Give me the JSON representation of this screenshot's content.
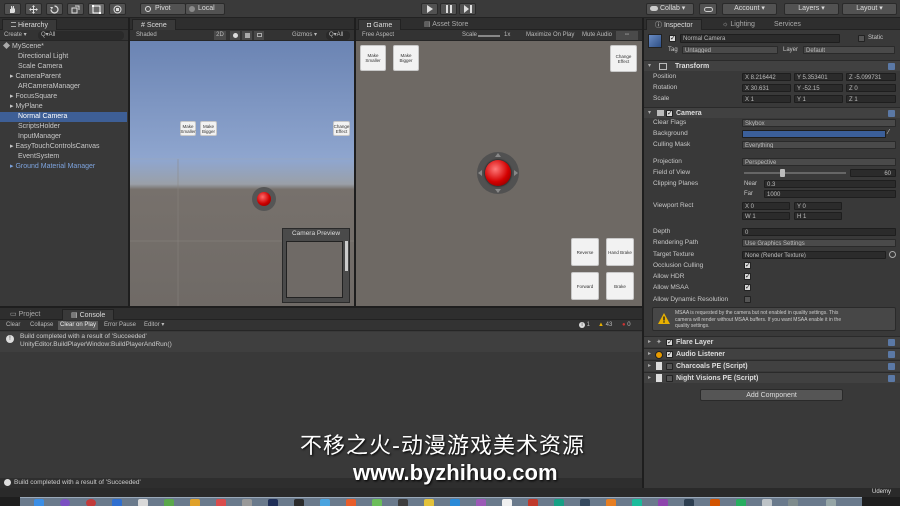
{
  "toolbar": {
    "pivot_label": "Pivot",
    "local_label": "Local",
    "collab_label": "Collab ▾",
    "account_label": "Account",
    "layers_label": "Layers",
    "layout_label": "Layout"
  },
  "hierarchy": {
    "tab": "Hierarchy",
    "create_label": "Create ▾",
    "search_prefix": "Q▾All",
    "scene_name": "MyScene*",
    "items": [
      {
        "label": "Directional Light",
        "indent": 1
      },
      {
        "label": "Scale Camera",
        "indent": 1
      },
      {
        "label": "▸ CameraParent",
        "indent": 0
      },
      {
        "label": "ARCameraManager",
        "indent": 1
      },
      {
        "label": "▸ FocusSquare",
        "indent": 0
      },
      {
        "label": "▸ MyPlane",
        "indent": 0
      },
      {
        "label": "Normal Camera",
        "indent": 1,
        "selected": true
      },
      {
        "label": "ScriptsHolder",
        "indent": 1
      },
      {
        "label": "InputManager",
        "indent": 1
      },
      {
        "label": "▸ EasyTouchControlsCanvas",
        "indent": 0
      },
      {
        "label": "EventSystem",
        "indent": 1
      },
      {
        "label": "▸ Ground Material Manager",
        "indent": 0,
        "blue": true
      }
    ]
  },
  "scene": {
    "tab": "Scene",
    "shaded_label": "Shaded",
    "twod_label": "2D",
    "gizmos_label": "Gizmos ▾",
    "mini_make_smaller": "Make Smaller",
    "mini_make_bigger": "Make Bigger",
    "mini_change_effect": "Change Effect",
    "camera_preview_title": "Camera Preview"
  },
  "game": {
    "tab": "Game",
    "asset_store_tab": "Asset Store",
    "aspect_label": "Free Aspect",
    "scale_label": "Scale",
    "scale_value": "1x",
    "maximize_label": "Maximize On Play",
    "mute_label": "Mute Audio",
    "make_smaller": "Make Smaller",
    "make_bigger": "Make Bigger",
    "change_effect": "Change Effect",
    "reverse": "Reverse",
    "hand_brake": "Hand Brake",
    "forward": "Forward",
    "brake": "Brake"
  },
  "inspector": {
    "tabs": [
      "Inspector",
      "Lighting",
      "Services"
    ],
    "object_name": "Normal Camera",
    "static_label": "Static",
    "tag_label": "Tag",
    "tag_value": "Untagged",
    "layer_label": "Layer",
    "layer_value": "Default",
    "transform": {
      "title": "Transform",
      "position_label": "Position",
      "rotation_label": "Rotation",
      "scale_label": "Scale",
      "position": [
        "X  8.216442",
        "Y  5.353401",
        "Z  -5.099731"
      ],
      "rotation": [
        "X  30.631",
        "Y  -52.15",
        "Z  0"
      ],
      "scale": [
        "X  1",
        "Y  1",
        "Z  1"
      ]
    },
    "camera": {
      "title": "Camera",
      "clear_flags_label": "Clear Flags",
      "clear_flags_value": "Skybox",
      "background_label": "Background",
      "background_color": "#3b5f9a",
      "culling_mask_label": "Culling Mask",
      "culling_mask_value": "Everything",
      "projection_label": "Projection",
      "projection_value": "Perspective",
      "fov_label": "Field of View",
      "fov_value": "60",
      "clipping_label": "Clipping Planes",
      "near_label": "Near",
      "near_value": "0.3",
      "far_label": "Far",
      "far_value": "1000",
      "viewport_label": "Viewport Rect",
      "vx": "X  0",
      "vy": "Y  0",
      "vw": "W  1",
      "vh": "H  1",
      "depth_label": "Depth",
      "depth_value": "0",
      "render_path_label": "Rendering Path",
      "render_path_value": "Use Graphics Settings",
      "target_tex_label": "Target Texture",
      "target_tex_value": "None (Render Texture)",
      "occlusion_label": "Occlusion Culling",
      "hdr_label": "Allow HDR",
      "msaa_label": "Allow MSAA",
      "dyn_res_label": "Allow Dynamic Resolution",
      "warning_line1": "MSAA is requested by the camera but not enabled in quality settings. This",
      "warning_line2": "camera will render without MSAA buffers. If you want MSAA enable it in the",
      "warning_line3": "quality settings."
    },
    "components": [
      "Flare Layer",
      "Audio Listener",
      "Charcoals PE (Script)",
      "Night Visions PE (Script)"
    ],
    "add_component": "Add Component"
  },
  "console": {
    "project_tab": "Project",
    "console_tab": "Console",
    "clear": "Clear",
    "collapse": "Collapse",
    "clear_on_play": "Clear on Play",
    "error_pause": "Error Pause",
    "editor": "Editor ▾",
    "info_count": "1",
    "warn_count": "43",
    "error_count": "0",
    "log_line1": "Build completed with a result of 'Succeeded'",
    "log_line2": "UnityEditor.BuildPlayerWindow:BuildPlayerAndRun()",
    "status": "Build completed with a result of 'Succeeded'"
  },
  "watermark": {
    "line1": "不移之火-动漫游戏美术资源",
    "line2": "www.byzhihuo.com",
    "udemy": "Udemy"
  }
}
